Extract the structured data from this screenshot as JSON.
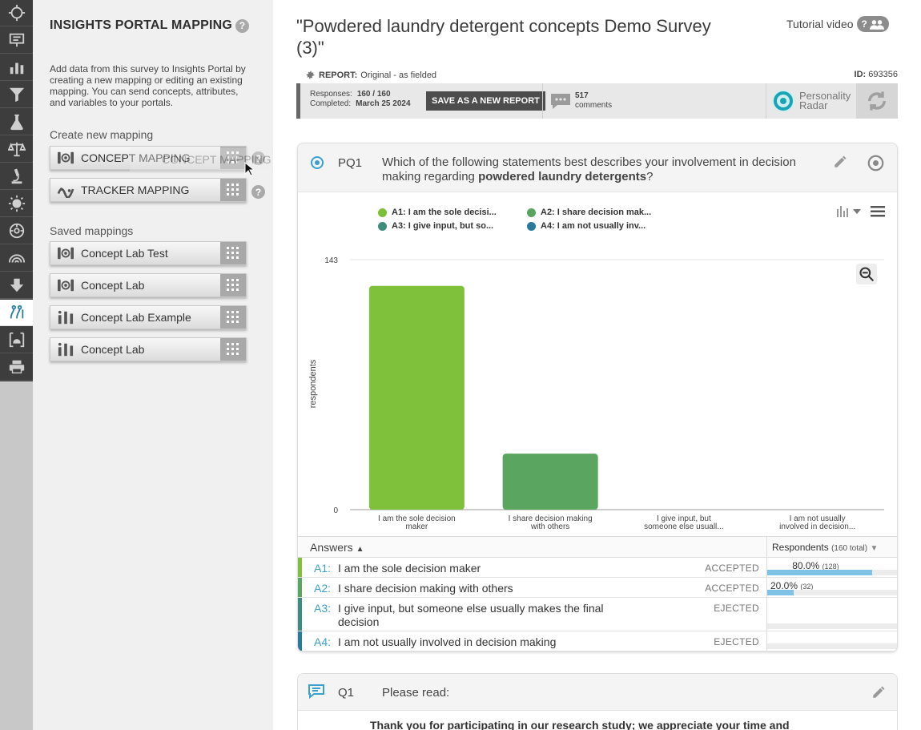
{
  "panel": {
    "title": "INSIGHTS PORTAL MAPPING",
    "description": "Add data from this survey to Insights Portal by creating a new mapping or editing an existing mapping. You can send concepts, attributes, and variables to your portals.",
    "create_heading": "Create new mapping",
    "create_items": [
      {
        "label": "CONCEPT MAPPING",
        "icon": "concept-icon"
      },
      {
        "label": "TRACKER MAPPING",
        "icon": "tracker-icon"
      }
    ],
    "drag_ghost_label": "CONCEPT MAPPING",
    "saved_heading": "Saved mappings",
    "saved_items": [
      {
        "label": "Concept Lab Test",
        "icon": "concept-icon"
      },
      {
        "label": "Concept Lab",
        "icon": "concept-icon"
      },
      {
        "label": "Concept Lab Example",
        "icon": "tracker-bars-icon"
      },
      {
        "label": "Concept Lab",
        "icon": "tracker-bars-icon"
      }
    ],
    "help_glyph": "?"
  },
  "rail": {
    "icons": [
      "crosshair-icon",
      "presentation-icon",
      "bar-chart-icon",
      "filter-icon",
      "flask-icon",
      "scales-icon",
      "microscope-icon",
      "sun-icon",
      "brain-icon",
      "signal-icon",
      "download-icon",
      "mapping-icon",
      "portal-icon",
      "print-icon"
    ],
    "active": "mapping-icon"
  },
  "survey": {
    "title": "\"Powdered laundry detergent concepts Demo Survey (3)\"",
    "tutorial_label": "Tutorial video",
    "tutorial_badge": "?",
    "report_label": "REPORT:",
    "report_value": "Original - as fielded",
    "id_label": "ID:",
    "id_value": "693356"
  },
  "toolbar": {
    "responses_label": "Responses:",
    "responses_value": "160 / 160",
    "completed_label": "Completed:",
    "completed_value": "March 25 2024",
    "save_label": "SAVE AS A NEW REPORT",
    "comments_count": "517",
    "comments_label": "comments",
    "personality_line1": "Personality",
    "personality_line2": "Radar"
  },
  "question": {
    "id": "PQ1",
    "text_before": "Which of the following statements best describes your involvement in decision making regarding ",
    "text_bold": "powdered laundry detergents",
    "text_after": "?"
  },
  "legend": [
    {
      "label": "A1: I am the sole decisi...",
      "color": "#7ebf3a"
    },
    {
      "label": "A2: I share decision mak...",
      "color": "#58a35e"
    },
    {
      "label": "A3: I give input, but so...",
      "color": "#3e8c7d"
    },
    {
      "label": "A4: I am not usually inv...",
      "color": "#2a7b9b"
    }
  ],
  "chart_data": {
    "type": "bar",
    "categories": [
      [
        "I am the sole decision",
        "maker"
      ],
      [
        "I share decision making",
        "with others"
      ],
      [
        "I give input, but",
        "someone else usuall..."
      ],
      [
        "I am not usually",
        "involved in decision..."
      ]
    ],
    "values": [
      128,
      32,
      0,
      0
    ],
    "colors": [
      "#80c13c",
      "#5aa55f",
      "#3e8c7d",
      "#2a7b9b"
    ],
    "ylabel": "respondents",
    "ylim": [
      0,
      143
    ],
    "ytick_labels": [
      "0",
      "143"
    ],
    "grid": true,
    "legend_placement": "top"
  },
  "answers": {
    "header": "Answers",
    "sort_glyph": "▲",
    "resp_header": "Respondents",
    "resp_total": "(160 total)",
    "resp_sort_glyph": "▼",
    "rows": [
      {
        "key": "A1:",
        "text": "I am the sole decision maker",
        "status": "ACCEPTED",
        "pct": "80.0%",
        "count": "(128)",
        "fraction": 0.8,
        "color": "#80c13c"
      },
      {
        "key": "A2:",
        "text": "I share decision making with others",
        "status": "ACCEPTED",
        "pct": "20.0%",
        "count": "(32)",
        "fraction": 0.2,
        "color": "#5aa55f"
      },
      {
        "key": "A3:",
        "text": "I give input, but someone else usually makes the final decision",
        "status": "EJECTED",
        "pct": "",
        "count": "",
        "fraction": 0,
        "color": "#3e8c7d"
      },
      {
        "key": "A4:",
        "text": "I am not usually involved in decision making",
        "status": "EJECTED",
        "pct": "",
        "count": "",
        "fraction": 0,
        "color": "#2a7b9b"
      }
    ]
  },
  "q1": {
    "id": "Q1",
    "text": "Please read:",
    "body": "Thank you for participating in our research study; we appreciate your time and"
  }
}
